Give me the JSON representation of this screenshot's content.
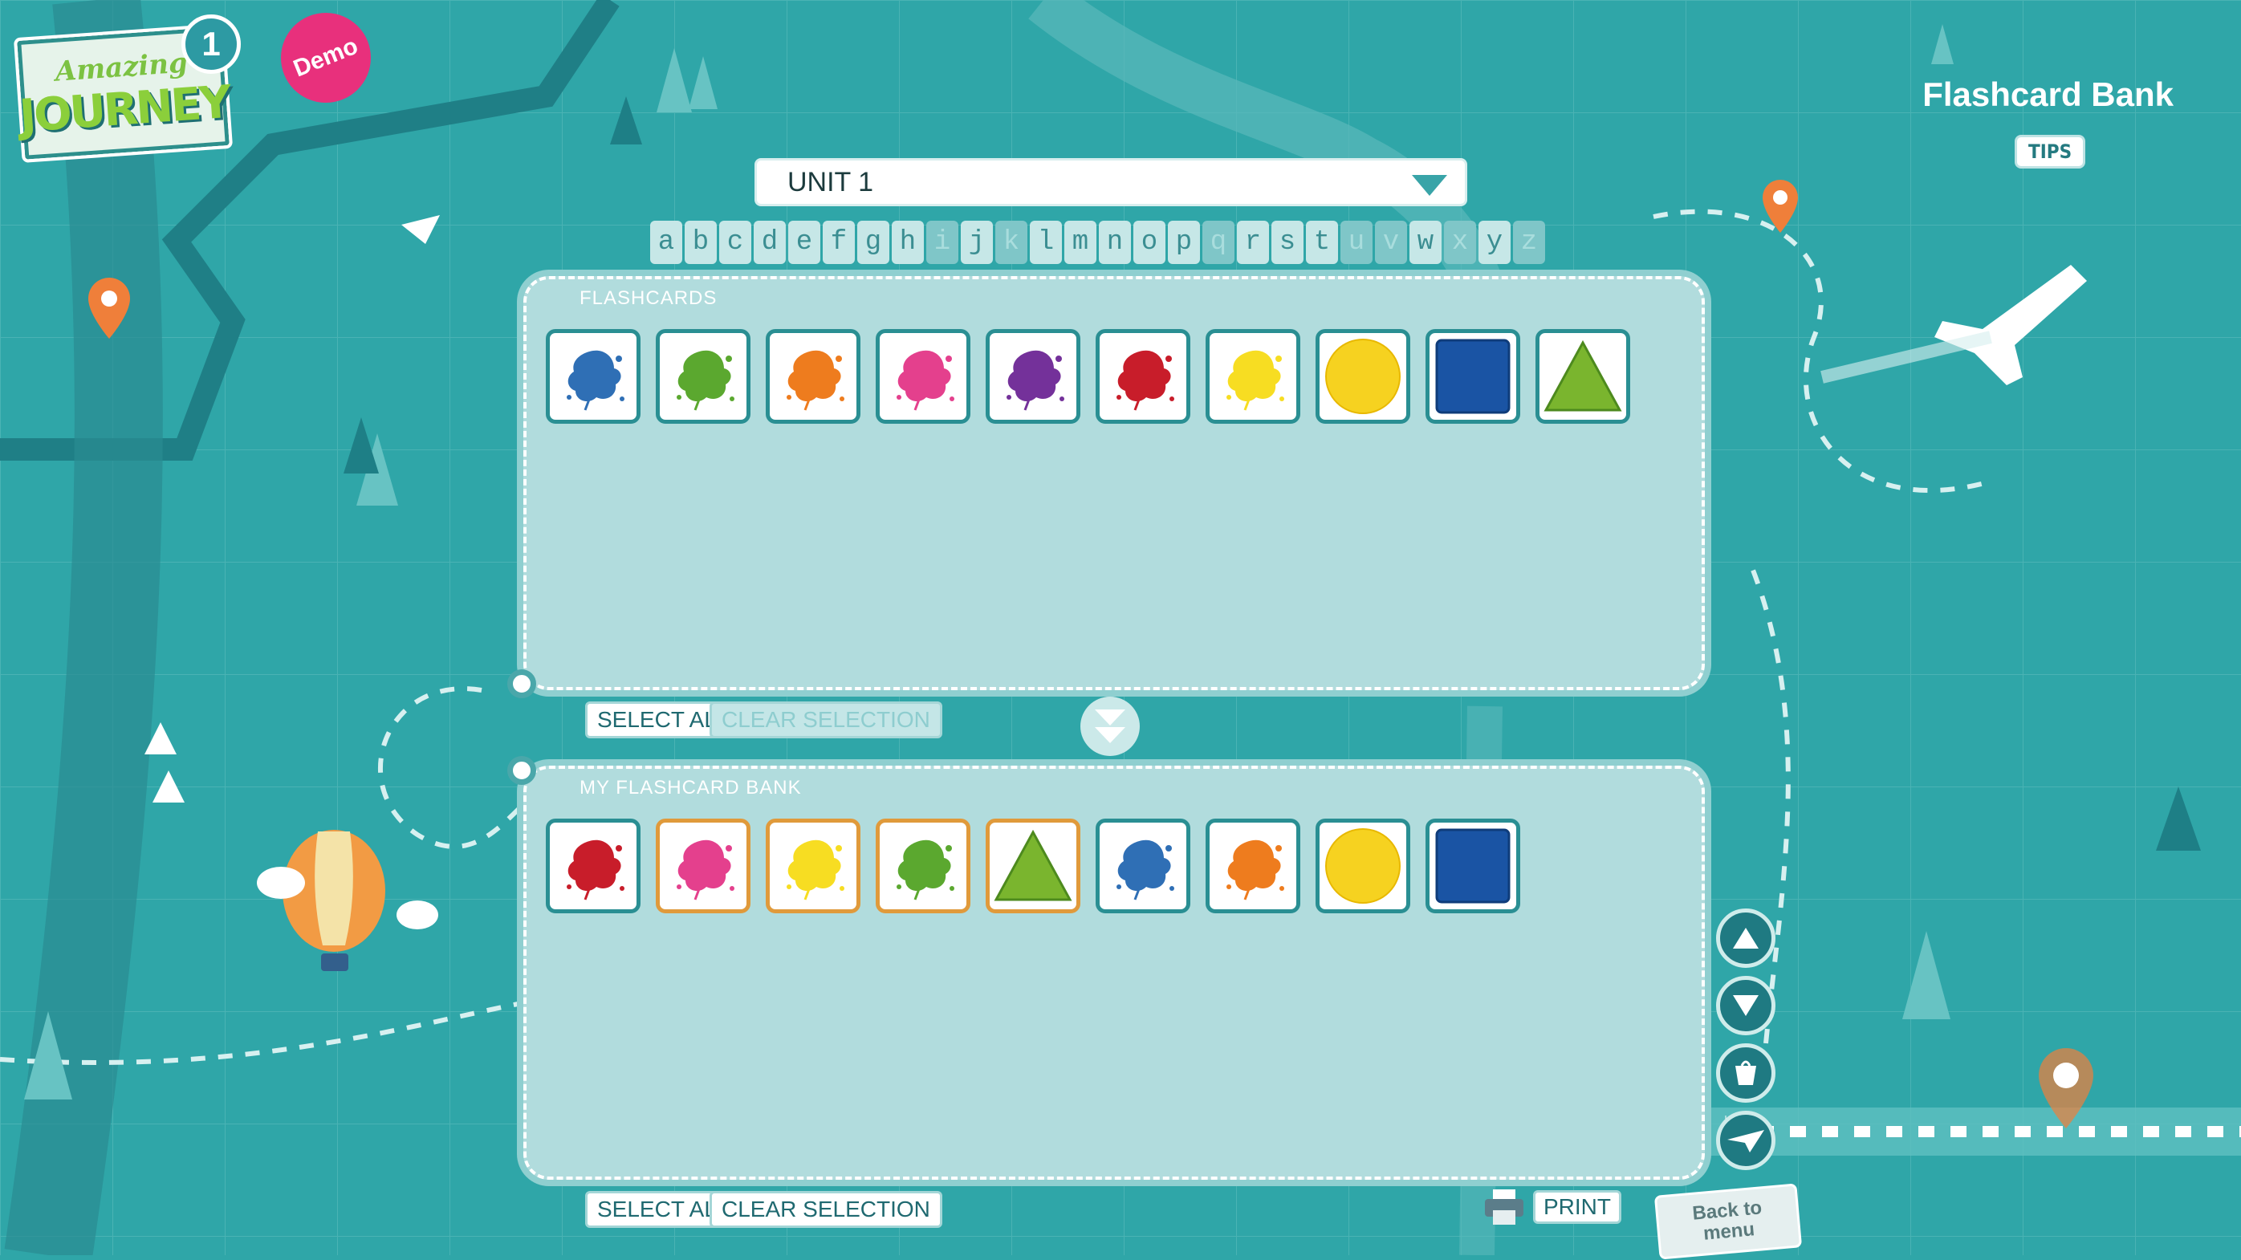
{
  "app": {
    "logo_small": "Amazing",
    "logo_big": "JOURNEY",
    "level": "1",
    "badge": "Demo"
  },
  "page_title": "Flashcard Bank",
  "tips_label": "TIPS",
  "unit_select": {
    "value": "UNIT 1"
  },
  "letters": [
    {
      "ch": "a",
      "enabled": true
    },
    {
      "ch": "b",
      "enabled": true
    },
    {
      "ch": "c",
      "enabled": true
    },
    {
      "ch": "d",
      "enabled": true
    },
    {
      "ch": "e",
      "enabled": true
    },
    {
      "ch": "f",
      "enabled": true
    },
    {
      "ch": "g",
      "enabled": true
    },
    {
      "ch": "h",
      "enabled": true
    },
    {
      "ch": "i",
      "enabled": false
    },
    {
      "ch": "j",
      "enabled": true
    },
    {
      "ch": "k",
      "enabled": false
    },
    {
      "ch": "l",
      "enabled": true
    },
    {
      "ch": "m",
      "enabled": true
    },
    {
      "ch": "n",
      "enabled": true
    },
    {
      "ch": "o",
      "enabled": true
    },
    {
      "ch": "p",
      "enabled": true
    },
    {
      "ch": "q",
      "enabled": false
    },
    {
      "ch": "r",
      "enabled": true
    },
    {
      "ch": "s",
      "enabled": true
    },
    {
      "ch": "t",
      "enabled": true
    },
    {
      "ch": "u",
      "enabled": false
    },
    {
      "ch": "v",
      "enabled": false
    },
    {
      "ch": "w",
      "enabled": true
    },
    {
      "ch": "x",
      "enabled": false
    },
    {
      "ch": "y",
      "enabled": true
    },
    {
      "ch": "z",
      "enabled": false
    }
  ],
  "flashcards_panel": {
    "label": "FLASHCARDS",
    "cards": [
      {
        "icon": "blue-splash-icon",
        "color": "#2f6fb5",
        "shape": "splash",
        "selected": false
      },
      {
        "icon": "green-splash-icon",
        "color": "#5ba82f",
        "shape": "splash",
        "selected": false
      },
      {
        "icon": "orange-splash-icon",
        "color": "#ee7c1e",
        "shape": "splash",
        "selected": false
      },
      {
        "icon": "pink-splash-icon",
        "color": "#e4408d",
        "shape": "splash",
        "selected": false
      },
      {
        "icon": "purple-splash-icon",
        "color": "#74319a",
        "shape": "splash",
        "selected": false
      },
      {
        "icon": "red-splash-icon",
        "color": "#c81d2a",
        "shape": "splash",
        "selected": false
      },
      {
        "icon": "yellow-splash-icon",
        "color": "#f7dd22",
        "shape": "splash",
        "selected": false
      },
      {
        "icon": "yellow-circle-icon",
        "color": "#f6d220",
        "shape": "circle",
        "selected": false
      },
      {
        "icon": "blue-square-icon",
        "color": "#1a54a4",
        "shape": "square",
        "selected": false
      },
      {
        "icon": "green-triangle-icon",
        "color": "#7ab52e",
        "shape": "triangle",
        "selected": false
      }
    ],
    "select_all": "SELECT ALL",
    "clear_selection": "CLEAR SELECTION"
  },
  "bank_panel": {
    "label": "MY FLASHCARD BANK",
    "cards": [
      {
        "icon": "red-splash-icon",
        "color": "#c81d2a",
        "shape": "splash",
        "selected": false
      },
      {
        "icon": "pink-splash-icon",
        "color": "#e4408d",
        "shape": "splash",
        "selected": true
      },
      {
        "icon": "yellow-splash-icon",
        "color": "#f7dd22",
        "shape": "splash",
        "selected": true
      },
      {
        "icon": "green-splash-icon",
        "color": "#5ba82f",
        "shape": "splash",
        "selected": true
      },
      {
        "icon": "green-triangle-icon",
        "color": "#7ab52e",
        "shape": "triangle",
        "selected": true
      },
      {
        "icon": "blue-splash-icon",
        "color": "#2f6fb5",
        "shape": "splash",
        "selected": false
      },
      {
        "icon": "orange-splash-icon",
        "color": "#ee7c1e",
        "shape": "splash",
        "selected": false
      },
      {
        "icon": "yellow-circle-icon",
        "color": "#f6d220",
        "shape": "circle",
        "selected": false
      },
      {
        "icon": "blue-square-icon",
        "color": "#1a54a4",
        "shape": "square",
        "selected": false
      }
    ],
    "select_all": "SELECT ALL",
    "clear_selection": "CLEAR SELECTION"
  },
  "print_label": "PRINT",
  "back_label": "Back to\nmenu",
  "colors": {
    "background": "#2fa6a8",
    "panel": "#b1dcdd",
    "card_border": "#2a8f93",
    "selected_border": "#e09a3b",
    "demo": "#e8307c"
  }
}
